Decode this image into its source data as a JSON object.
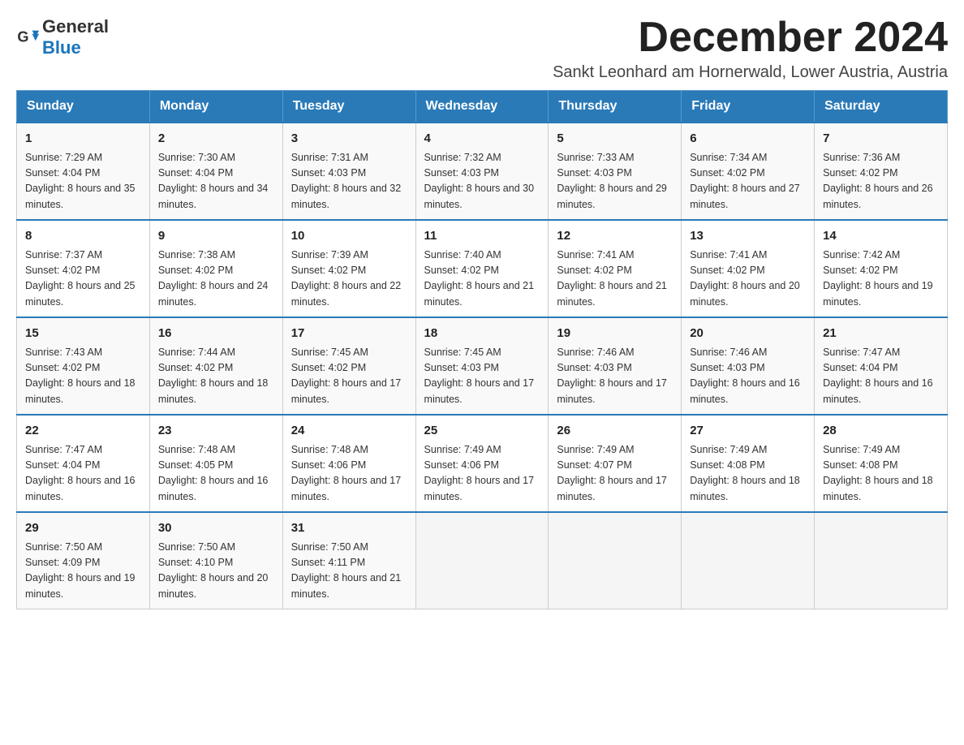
{
  "logo": {
    "text_general": "General",
    "text_blue": "Blue"
  },
  "title": "December 2024",
  "subtitle": "Sankt Leonhard am Hornerwald, Lower Austria, Austria",
  "days_of_week": [
    "Sunday",
    "Monday",
    "Tuesday",
    "Wednesday",
    "Thursday",
    "Friday",
    "Saturday"
  ],
  "weeks": [
    [
      {
        "day": "1",
        "sunrise": "7:29 AM",
        "sunset": "4:04 PM",
        "daylight": "8 hours and 35 minutes."
      },
      {
        "day": "2",
        "sunrise": "7:30 AM",
        "sunset": "4:04 PM",
        "daylight": "8 hours and 34 minutes."
      },
      {
        "day": "3",
        "sunrise": "7:31 AM",
        "sunset": "4:03 PM",
        "daylight": "8 hours and 32 minutes."
      },
      {
        "day": "4",
        "sunrise": "7:32 AM",
        "sunset": "4:03 PM",
        "daylight": "8 hours and 30 minutes."
      },
      {
        "day": "5",
        "sunrise": "7:33 AM",
        "sunset": "4:03 PM",
        "daylight": "8 hours and 29 minutes."
      },
      {
        "day": "6",
        "sunrise": "7:34 AM",
        "sunset": "4:02 PM",
        "daylight": "8 hours and 27 minutes."
      },
      {
        "day": "7",
        "sunrise": "7:36 AM",
        "sunset": "4:02 PM",
        "daylight": "8 hours and 26 minutes."
      }
    ],
    [
      {
        "day": "8",
        "sunrise": "7:37 AM",
        "sunset": "4:02 PM",
        "daylight": "8 hours and 25 minutes."
      },
      {
        "day": "9",
        "sunrise": "7:38 AM",
        "sunset": "4:02 PM",
        "daylight": "8 hours and 24 minutes."
      },
      {
        "day": "10",
        "sunrise": "7:39 AM",
        "sunset": "4:02 PM",
        "daylight": "8 hours and 22 minutes."
      },
      {
        "day": "11",
        "sunrise": "7:40 AM",
        "sunset": "4:02 PM",
        "daylight": "8 hours and 21 minutes."
      },
      {
        "day": "12",
        "sunrise": "7:41 AM",
        "sunset": "4:02 PM",
        "daylight": "8 hours and 21 minutes."
      },
      {
        "day": "13",
        "sunrise": "7:41 AM",
        "sunset": "4:02 PM",
        "daylight": "8 hours and 20 minutes."
      },
      {
        "day": "14",
        "sunrise": "7:42 AM",
        "sunset": "4:02 PM",
        "daylight": "8 hours and 19 minutes."
      }
    ],
    [
      {
        "day": "15",
        "sunrise": "7:43 AM",
        "sunset": "4:02 PM",
        "daylight": "8 hours and 18 minutes."
      },
      {
        "day": "16",
        "sunrise": "7:44 AM",
        "sunset": "4:02 PM",
        "daylight": "8 hours and 18 minutes."
      },
      {
        "day": "17",
        "sunrise": "7:45 AM",
        "sunset": "4:02 PM",
        "daylight": "8 hours and 17 minutes."
      },
      {
        "day": "18",
        "sunrise": "7:45 AM",
        "sunset": "4:03 PM",
        "daylight": "8 hours and 17 minutes."
      },
      {
        "day": "19",
        "sunrise": "7:46 AM",
        "sunset": "4:03 PM",
        "daylight": "8 hours and 17 minutes."
      },
      {
        "day": "20",
        "sunrise": "7:46 AM",
        "sunset": "4:03 PM",
        "daylight": "8 hours and 16 minutes."
      },
      {
        "day": "21",
        "sunrise": "7:47 AM",
        "sunset": "4:04 PM",
        "daylight": "8 hours and 16 minutes."
      }
    ],
    [
      {
        "day": "22",
        "sunrise": "7:47 AM",
        "sunset": "4:04 PM",
        "daylight": "8 hours and 16 minutes."
      },
      {
        "day": "23",
        "sunrise": "7:48 AM",
        "sunset": "4:05 PM",
        "daylight": "8 hours and 16 minutes."
      },
      {
        "day": "24",
        "sunrise": "7:48 AM",
        "sunset": "4:06 PM",
        "daylight": "8 hours and 17 minutes."
      },
      {
        "day": "25",
        "sunrise": "7:49 AM",
        "sunset": "4:06 PM",
        "daylight": "8 hours and 17 minutes."
      },
      {
        "day": "26",
        "sunrise": "7:49 AM",
        "sunset": "4:07 PM",
        "daylight": "8 hours and 17 minutes."
      },
      {
        "day": "27",
        "sunrise": "7:49 AM",
        "sunset": "4:08 PM",
        "daylight": "8 hours and 18 minutes."
      },
      {
        "day": "28",
        "sunrise": "7:49 AM",
        "sunset": "4:08 PM",
        "daylight": "8 hours and 18 minutes."
      }
    ],
    [
      {
        "day": "29",
        "sunrise": "7:50 AM",
        "sunset": "4:09 PM",
        "daylight": "8 hours and 19 minutes."
      },
      {
        "day": "30",
        "sunrise": "7:50 AM",
        "sunset": "4:10 PM",
        "daylight": "8 hours and 20 minutes."
      },
      {
        "day": "31",
        "sunrise": "7:50 AM",
        "sunset": "4:11 PM",
        "daylight": "8 hours and 21 minutes."
      },
      null,
      null,
      null,
      null
    ]
  ]
}
